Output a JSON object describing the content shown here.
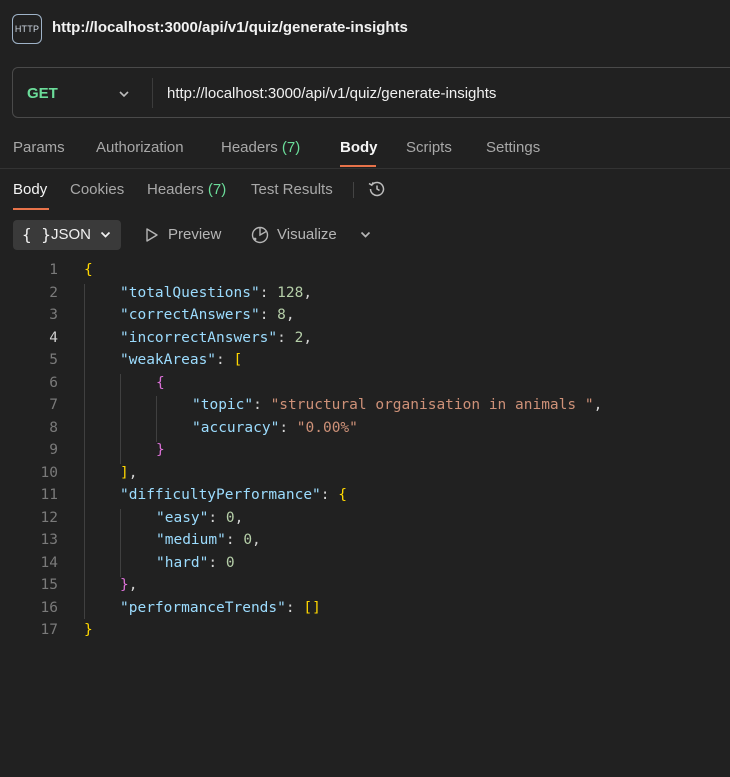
{
  "title_bar": {
    "icon_label": "HTTP",
    "title": "http://localhost:3000/api/v1/quiz/generate-insights"
  },
  "request": {
    "method": "GET",
    "url": "http://localhost:3000/api/v1/quiz/generate-insights"
  },
  "request_tabs": [
    {
      "label": "Params"
    },
    {
      "label": "Authorization"
    },
    {
      "label": "Headers",
      "count": "(7)"
    },
    {
      "label": "Body",
      "active": true
    },
    {
      "label": "Scripts"
    },
    {
      "label": "Settings"
    }
  ],
  "response_tabs": [
    {
      "label": "Body",
      "active": true
    },
    {
      "label": "Cookies"
    },
    {
      "label": "Headers",
      "count": "(7)"
    },
    {
      "label": "Test Results"
    }
  ],
  "toolbar": {
    "format_braces": "{ }",
    "format_label": "JSON",
    "preview_label": "Preview",
    "visualize_label": "Visualize"
  },
  "response_lines": [
    {
      "n": "1",
      "text": "{"
    },
    {
      "n": "2",
      "text": "\"totalQuestions\": 128,"
    },
    {
      "n": "3",
      "text": "\"correctAnswers\": 8,"
    },
    {
      "n": "4",
      "text": "\"incorrectAnswers\": 2,",
      "active": true
    },
    {
      "n": "5",
      "text": "\"weakAreas\": ["
    },
    {
      "n": "6",
      "text": "{"
    },
    {
      "n": "7",
      "text": "\"topic\": \"structural organisation in animals \","
    },
    {
      "n": "8",
      "text": "\"accuracy\": \"0.00%\""
    },
    {
      "n": "9",
      "text": "}"
    },
    {
      "n": "10",
      "text": "],"
    },
    {
      "n": "11",
      "text": "\"difficultyPerformance\": {"
    },
    {
      "n": "12",
      "text": "\"easy\": 0,"
    },
    {
      "n": "13",
      "text": "\"medium\": 0,"
    },
    {
      "n": "14",
      "text": "\"hard\": 0"
    },
    {
      "n": "15",
      "text": "},"
    },
    {
      "n": "16",
      "text": "\"performanceTrends\": []"
    },
    {
      "n": "17",
      "text": "}"
    }
  ],
  "colors": {
    "accent": "#e8734a",
    "method": "#6bdd9a",
    "key": "#9cdcfe",
    "string": "#ce9178",
    "number": "#b5cea8"
  }
}
